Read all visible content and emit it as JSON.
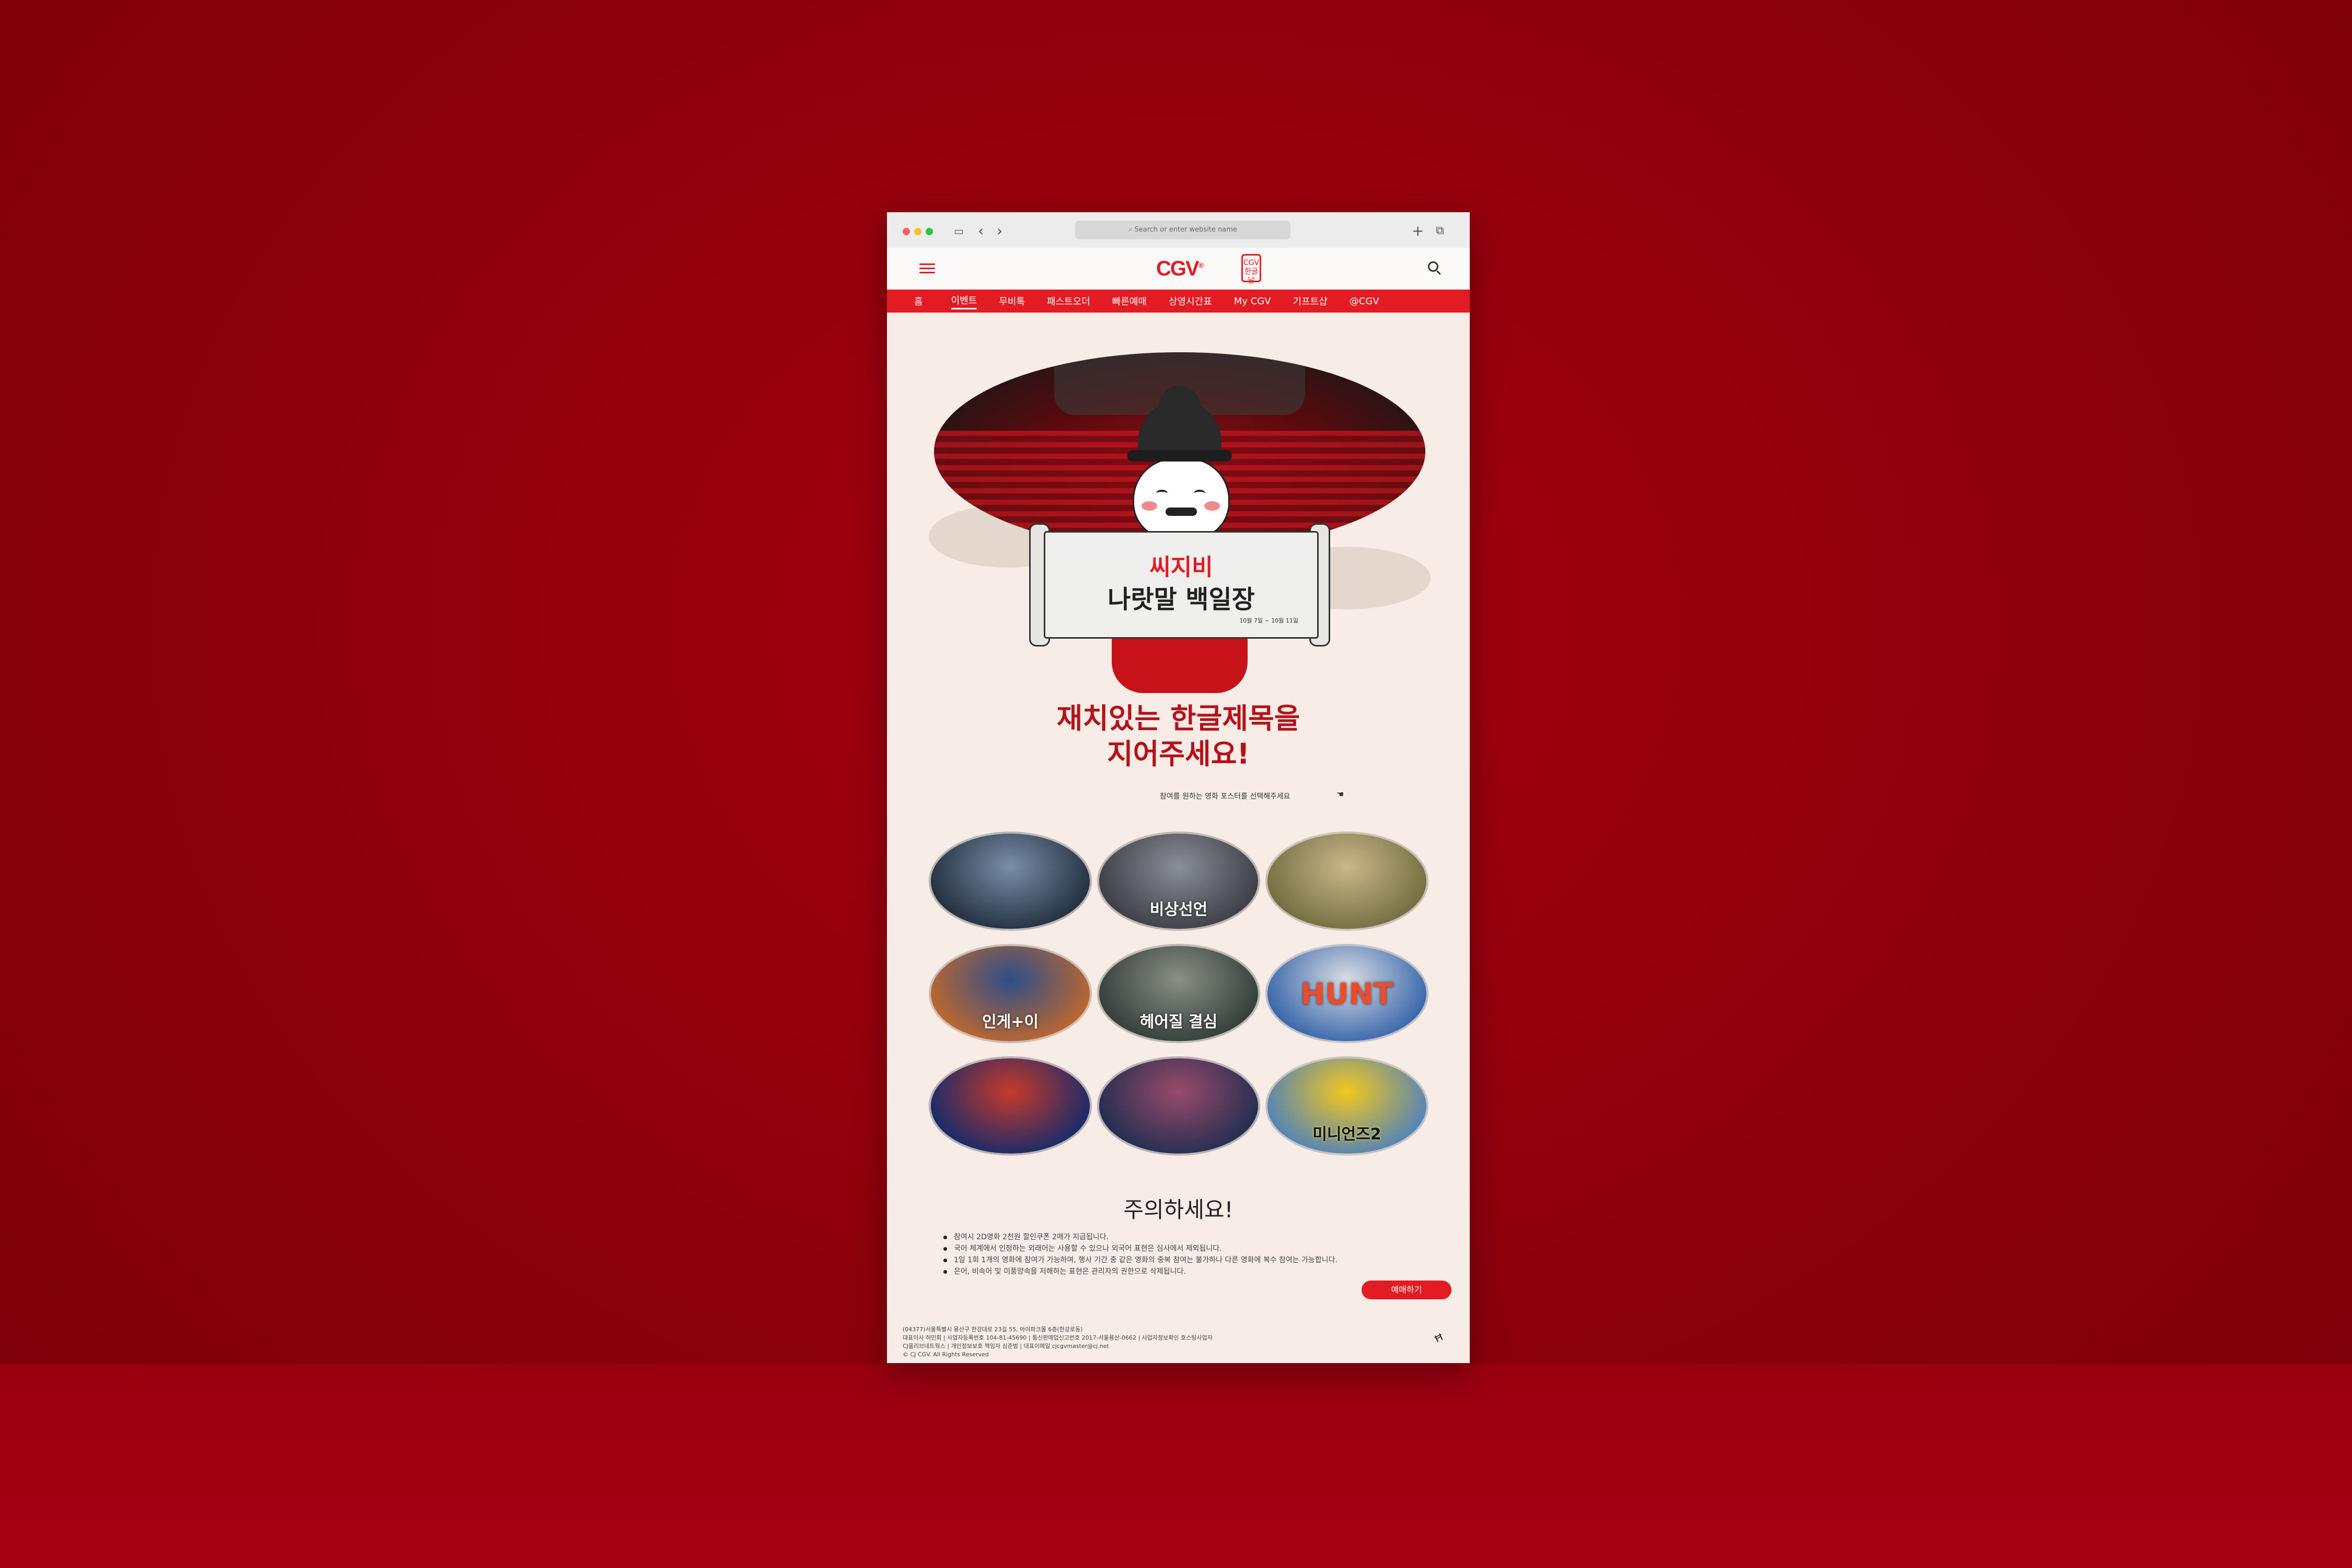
{
  "browser": {
    "url_placeholder": "Search or enter website name",
    "new_tab_icon": "+",
    "tabs_icon": "⧉"
  },
  "header": {
    "logo": "CGV",
    "logo_mark": "®",
    "badge": "CGV 한글날",
    "menu_icon": "hamburger-icon",
    "search_icon": "search-icon"
  },
  "nav": [
    "홈",
    "이벤트",
    "무비톡",
    "패스트오더",
    "빠른예매",
    "상영시간표",
    "My CGV",
    "기프트샵",
    "@CGV"
  ],
  "banner": {
    "title_red": "씨지비",
    "title_black": "나랏말 백일장",
    "dates": "10월 7일 ~ 10월 11일"
  },
  "headline": {
    "line1": "재치있는 한글제목을",
    "line2": "지어주세요!"
  },
  "instruction": "참여를 원하는 영화 포스터를 선택해주세요",
  "posters": [
    {
      "title": "",
      "colors": [
        "#1d2a3a",
        "#7a8ea8"
      ]
    },
    {
      "title": "비상선언",
      "colors": [
        "#3a3a40",
        "#8a8e96"
      ]
    },
    {
      "title": "",
      "colors": [
        "#6e6a3e",
        "#c8b88a"
      ]
    },
    {
      "title": "인게+이",
      "colors": [
        "#c5682a",
        "#2c4f8a"
      ]
    },
    {
      "title": "헤어질 결심",
      "colors": [
        "#2f3a36",
        "#8a8f86"
      ]
    },
    {
      "title": "HUNT",
      "colors": [
        "#2f5fa8",
        "#d9dde2"
      ]
    },
    {
      "title": "",
      "colors": [
        "#0e2a6e",
        "#c63a2a"
      ]
    },
    {
      "title": "",
      "colors": [
        "#1c2d4f",
        "#9a4a6a"
      ]
    },
    {
      "title": "미니언즈2",
      "colors": [
        "#4a7fbf",
        "#f2c81e"
      ]
    }
  ],
  "notice": {
    "title": "주의하세요!",
    "items": [
      "참여시 2D영화 2천원 할인쿠폰 2매가 지급됩니다.",
      "국어 체계에서 인정하는 외래어는 사용할 수 있으나 외국어 표현은 심사에서 제외됩니다.",
      "1일 1회 1개의 영화에 참여가 가능하며, 행사 기간 중 같은 영화의 중복 참여는 불가하나 다른 영화에 복수 참여는 가능합니다.",
      "은어, 비속어 및 미풍양속을 저해하는 표현은 관리자의 권한으로 삭제됩니다."
    ],
    "button": "예매하기"
  },
  "footer": {
    "lines": [
      "(04377)서울특별시 용산구 한강대로 23길 55, 아이파크몰 6층(한강로동)",
      "대표이사 허민회 | 사업자등록번호 104-81-45690 | 통신판매업신고번호 2017-서울용산-0662 | 사업자정보확인 호스팅사업자",
      "CJ올리브네트웍스 | 개인정보보호 책임자 심준범 | 대표이메일 cjcgvmaster@cj.net",
      "© CJ CGV. All Rights Reserved"
    ]
  }
}
